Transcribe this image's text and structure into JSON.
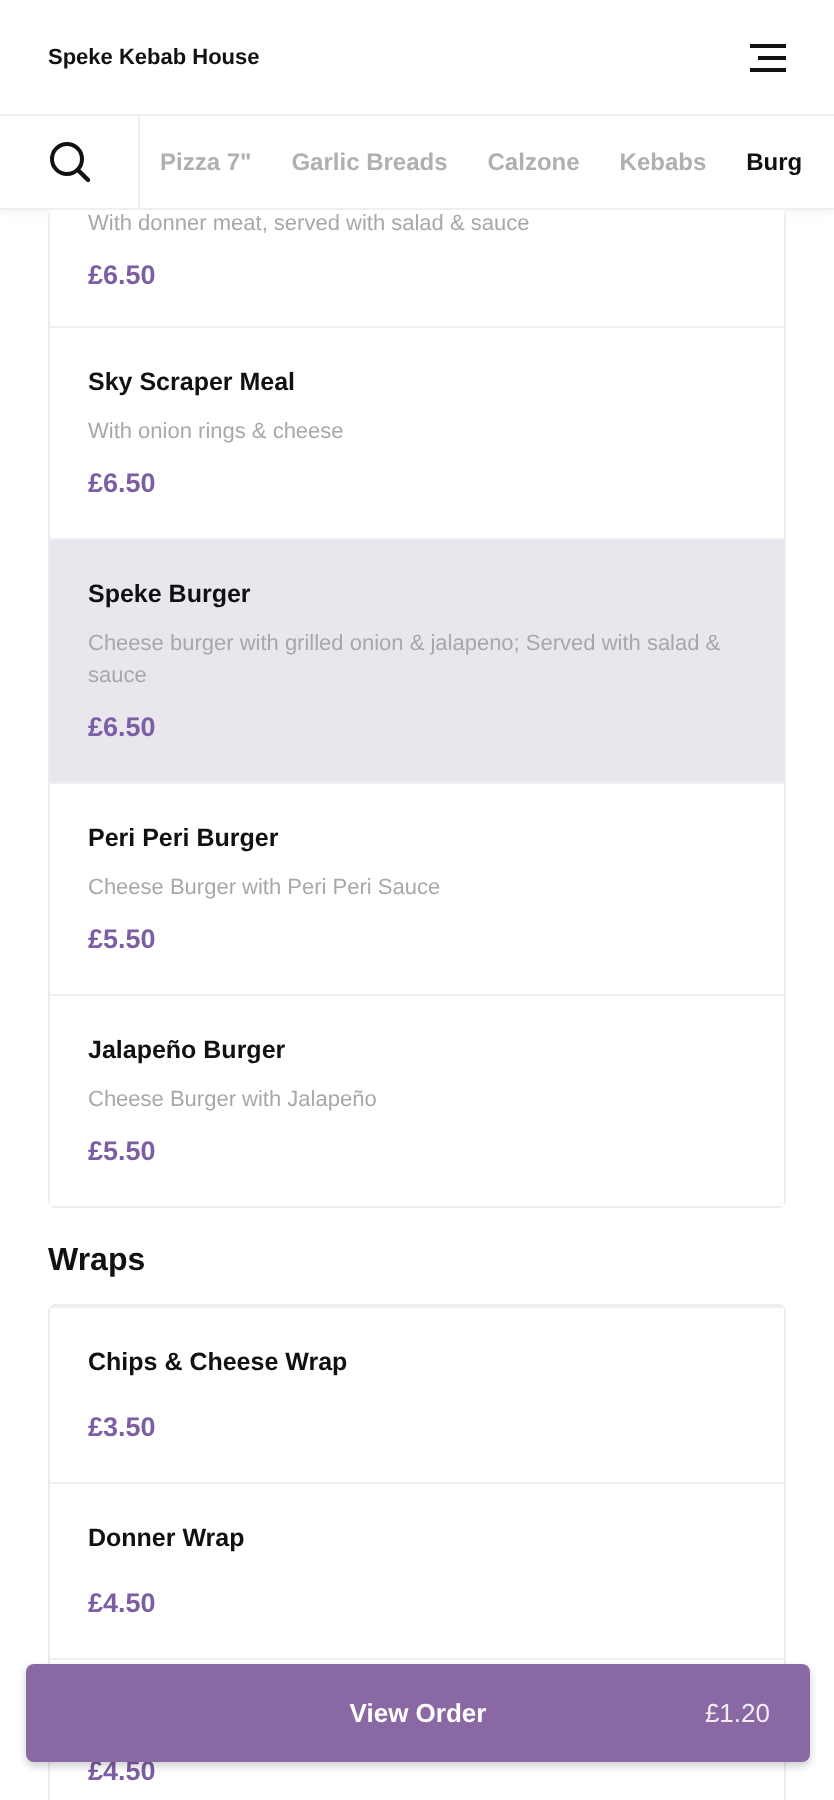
{
  "header": {
    "title": "Speke Kebab House"
  },
  "tabs": [
    {
      "label": "Pizza 7\"",
      "selected": false
    },
    {
      "label": "Garlic Breads",
      "selected": false
    },
    {
      "label": "Calzone",
      "selected": false
    },
    {
      "label": "Kebabs",
      "selected": false
    },
    {
      "label": "Burg",
      "selected": true
    }
  ],
  "sections": [
    {
      "items": [
        {
          "description": "With donner meat, served with salad & sauce",
          "price": "£6.50",
          "selected": false
        },
        {
          "name": "Sky Scraper Meal",
          "description": "With onion rings & cheese",
          "price": "£6.50",
          "selected": false
        },
        {
          "name": "Speke Burger",
          "description": "Cheese burger with grilled onion & jalapeno; Served with salad & sauce",
          "price": "£6.50",
          "selected": true
        },
        {
          "name": "Peri Peri Burger",
          "description": "Cheese Burger with Peri Peri Sauce",
          "price": "£5.50",
          "selected": false
        },
        {
          "name": "Jalapeño Burger",
          "description": "Cheese Burger with Jalapeño",
          "price": "£5.50",
          "selected": false
        }
      ]
    },
    {
      "title": "Wraps",
      "items": [
        {
          "name": "Chips & Cheese Wrap",
          "price": "£3.50",
          "selected": false
        },
        {
          "name": "Donner Wrap",
          "price": "£4.50",
          "selected": false
        },
        {
          "price": "£4.50"
        }
      ]
    }
  ],
  "order_bar": {
    "label": "View Order",
    "total": "£1.20"
  }
}
